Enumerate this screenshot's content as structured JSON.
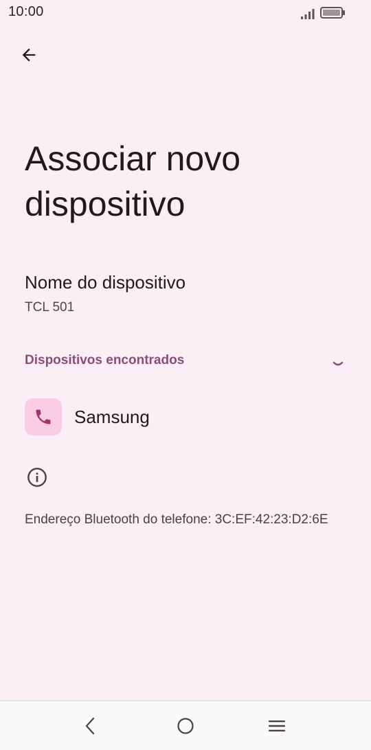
{
  "status_bar": {
    "time": "10:00"
  },
  "header": {
    "back_icon": "arrow-back-icon",
    "title": "Associar novo dispositivo"
  },
  "device_name": {
    "label": "Nome do dispositivo",
    "value": "TCL 501"
  },
  "found_devices": {
    "header": "Dispositivos encontrados",
    "items": [
      {
        "label": "Samsung",
        "icon": "phone-icon"
      }
    ]
  },
  "info": {
    "icon": "info-icon",
    "bt_address_text": "Endereço Bluetooth do telefone: 3C:EF:42:23:D2:6E"
  },
  "colors": {
    "background": "#fbeef4",
    "accent": "#8a4c79",
    "icon_container": "#f9cce4"
  }
}
